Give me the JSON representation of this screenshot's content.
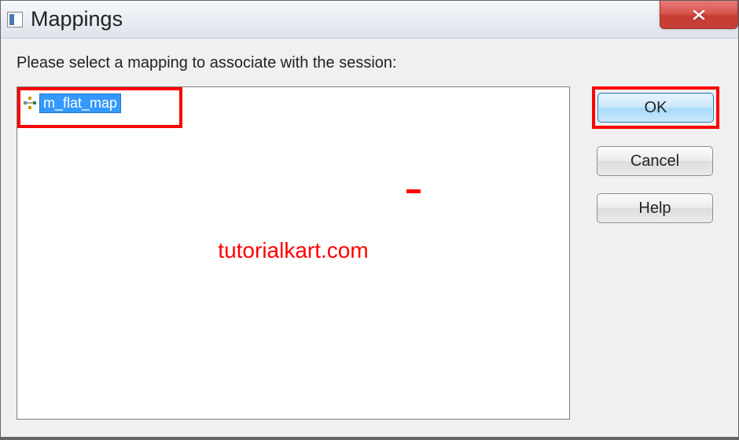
{
  "window": {
    "title": "Mappings"
  },
  "dialog": {
    "instruction": "Please select a mapping to associate with the session:",
    "list": {
      "items": [
        {
          "label": "m_flat_map",
          "selected": true
        }
      ]
    },
    "watermark": "tutorialkart.com",
    "buttons": {
      "ok": "OK",
      "cancel": "Cancel",
      "help": "Help"
    }
  }
}
